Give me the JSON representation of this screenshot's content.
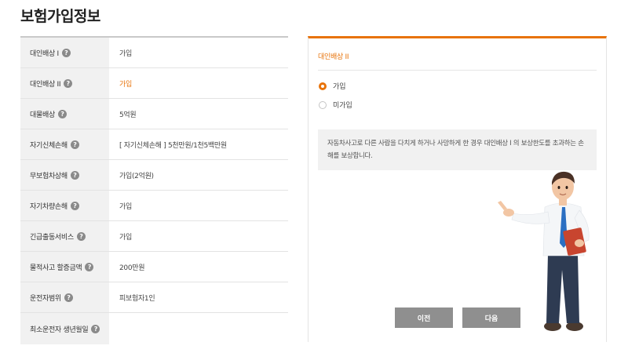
{
  "page": {
    "title": "보험가입정보"
  },
  "rows": [
    {
      "label": "대인배상 I",
      "value": "가입",
      "highlight": false
    },
    {
      "label": "대인배상 II",
      "value": "가입",
      "highlight": true
    },
    {
      "label": "대물배상",
      "value": "5억원",
      "highlight": false
    },
    {
      "label": "자기신체손해",
      "value": "[ 자기신체손해 ]  5천만원/1천5백만원",
      "highlight": false
    },
    {
      "label": "무보험차상해",
      "value": "가입(2억원)",
      "highlight": false
    },
    {
      "label": "자기차량손해",
      "value": "가입",
      "highlight": false
    },
    {
      "label": "긴급출동서비스",
      "value": "가입",
      "highlight": false
    },
    {
      "label": "물적사고 할증금액",
      "value": "200만원",
      "highlight": false
    },
    {
      "label": "운전자범위",
      "value": "피보험자1인",
      "highlight": false
    },
    {
      "label": "최소운전자 생년월일",
      "value": "",
      "highlight": false
    }
  ],
  "detail": {
    "title": "대인배상 II",
    "options": [
      {
        "label": "가입",
        "selected": true
      },
      {
        "label": "미가입",
        "selected": false
      }
    ],
    "description": "자동차사고로 다른 사람을 다치게 하거나 사망하게 한 경우 대인배상 I 의 보상한도를 초과하는 손해를 보상합니다.",
    "prev_label": "이전",
    "next_label": "다음"
  },
  "icons": {
    "help": "help-icon",
    "character": "businessman-pointing-illustration"
  },
  "colors": {
    "accent": "#e8730a",
    "button": "#8f8f8f",
    "label_bg": "#f1f1f1"
  }
}
